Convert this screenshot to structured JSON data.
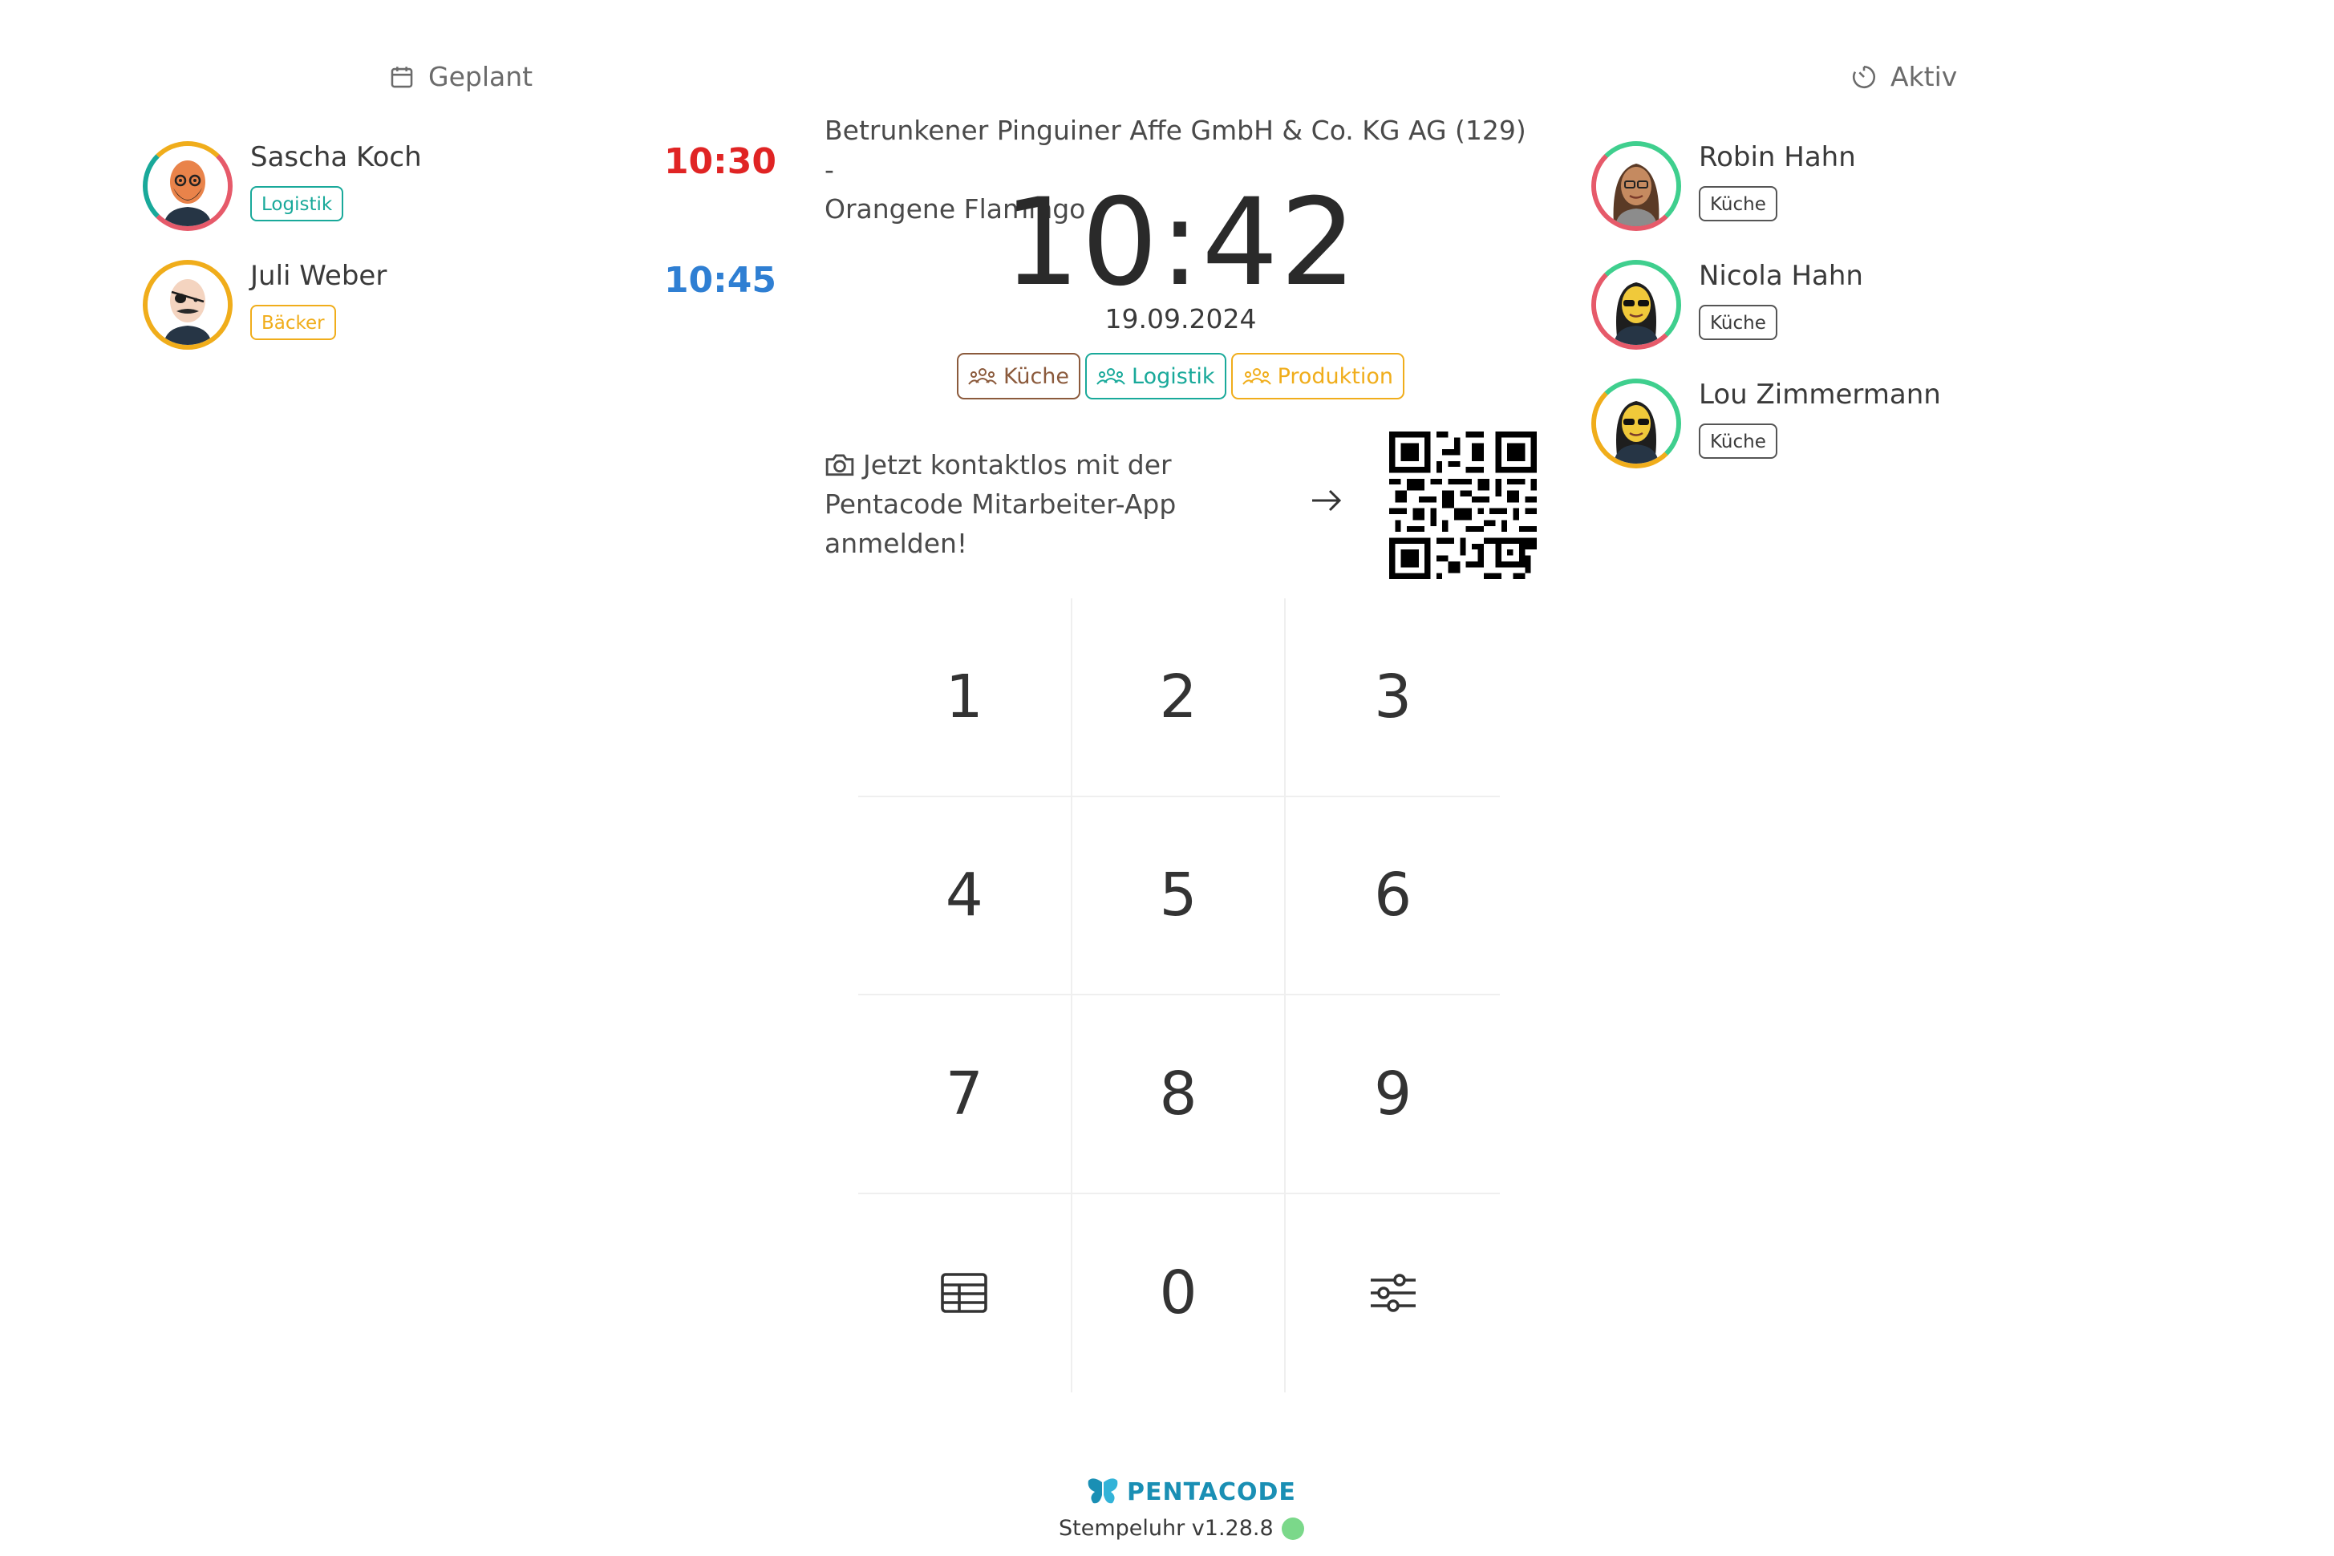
{
  "colors": {
    "kueche": "#8b5a3c",
    "logistik": "#19a99a",
    "produktion": "#f0ad1b",
    "baecker": "#f0ad1b",
    "late": "#e02424",
    "upcoming": "#2f7fd3",
    "status_online": "#7bd88a",
    "brand": "#1a8fb4"
  },
  "planned": {
    "header": "Geplant",
    "header_icon": "calendar-icon",
    "employees": [
      {
        "name": "Sascha Koch",
        "tag": "Logistik",
        "time": "10:30",
        "time_status": "late"
      },
      {
        "name": "Juli Weber",
        "tag": "Bäcker",
        "time": "10:45",
        "time_status": "upcoming"
      }
    ]
  },
  "active": {
    "header": "Aktiv",
    "header_icon": "timer-icon",
    "employees": [
      {
        "name": "Robin Hahn",
        "tag": "Küche"
      },
      {
        "name": "Nicola Hahn",
        "tag": "Küche"
      },
      {
        "name": "Lou Zimmermann",
        "tag": "Küche"
      }
    ]
  },
  "center": {
    "company_line1": "Betrunkener Pinguiner Affe GmbH & Co. KG AG (129) -",
    "company_line2": "Orangene Flamingo",
    "clock": "10:42",
    "date": "19.09.2024",
    "departments": [
      "Küche",
      "Logistik",
      "Produktion"
    ],
    "app_prompt": "Jetzt kontaktlos mit der Pentacode Mitarbeiter-App anmelden!"
  },
  "keypad": {
    "keys": [
      "1",
      "2",
      "3",
      "4",
      "5",
      "6",
      "7",
      "8",
      "9",
      "",
      "0",
      ""
    ],
    "left_action_icon": "table-icon",
    "right_action_icon": "sliders-icon"
  },
  "footer": {
    "brand": "PENTACODE",
    "version": "Stempeluhr v1.28.8"
  }
}
